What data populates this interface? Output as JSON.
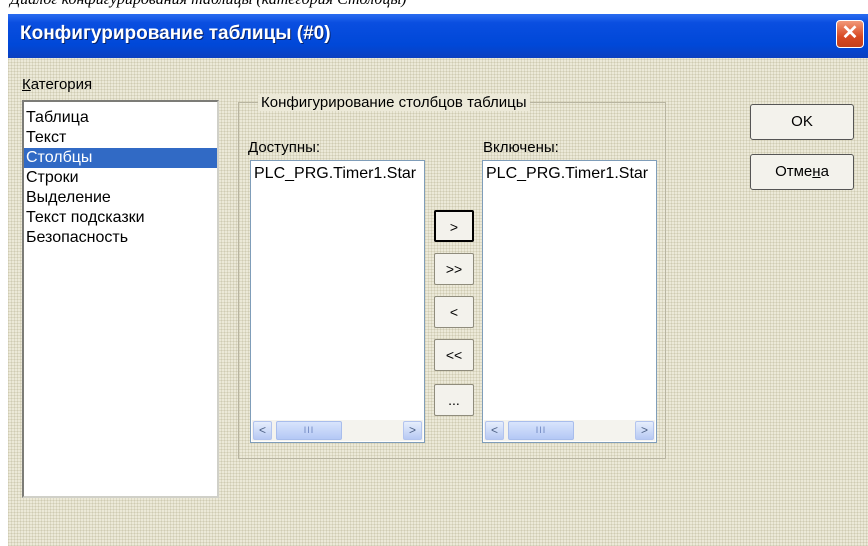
{
  "caption": "Диалог конфигурирования таблицы (категория Столбцы)",
  "window": {
    "title": "Конфигурирование таблицы (#0)",
    "close_glyph": "✕"
  },
  "category": {
    "label": "Категория",
    "items": [
      "Таблица",
      "Текст",
      "Столбцы",
      "Строки",
      "Выделение",
      "Текст подсказки",
      "Безопасность"
    ],
    "selected": "Столбцы"
  },
  "columns_group": {
    "title": "Конфигурирование столбцов таблицы",
    "available_label": "Доступны:",
    "available_items": [
      "PLC_PRG.Timer1.Star"
    ],
    "included_label": "Включены:",
    "included_items": [
      "PLC_PRG.Timer1.Star"
    ]
  },
  "move_buttons": {
    "add": ">",
    "add_all": ">>",
    "remove": "<",
    "remove_all": "<<",
    "more": "..."
  },
  "scrollbar": {
    "left": "<",
    "right": ">",
    "thumb": "III"
  },
  "dialog_buttons": {
    "ok": "OK",
    "cancel_prefix": "Отме",
    "cancel_underlined": "н",
    "cancel_suffix": "а"
  },
  "colors": {
    "title_bar": "#0048d8",
    "selection": "#316ac5",
    "close_button": "#d84a22",
    "dialog_bg": "#ece9d8"
  }
}
